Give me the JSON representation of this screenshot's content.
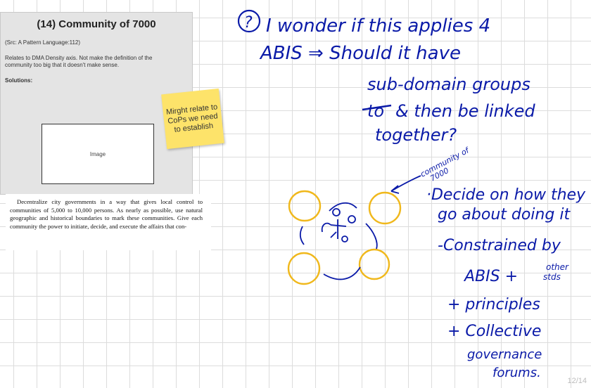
{
  "card": {
    "title": "(14) Community of 7000",
    "source": "(Src: A Pattern Language:112)",
    "description": "Relates to DMA Density axis.  Not make the definition of the community too big that it doesn't make sense.",
    "solutions_label": "Solutions:",
    "image_label": "Image"
  },
  "sticky_note": {
    "text": "Mirght relate to CoPs we need to establish",
    "color": "#fde36a"
  },
  "quote": {
    "text": "Decentralize city governments in a way that gives local control to communities of 5,000 to 10,000 persons. As nearly as possible, use natural geographic and historical boundaries to mark these communities. Give each community the power to initiate, decide, and execute the affairs that con-"
  },
  "handwriting": {
    "question_mark": "?",
    "line1": "I wonder if this applies 4",
    "line2": "ABIS ⇒ Should it have",
    "line3": "sub-domain groups",
    "line4_struck": "to",
    "line4": "& then be linked",
    "line5": "together?",
    "community_label_1": "community of",
    "community_label_2": "7000",
    "note1": "·Decide on how they",
    "note2": "go about doing it",
    "note3": "-Constrained by",
    "note4": "ABIS +",
    "note4_sup_1": "other",
    "note4_sup_2": "stds",
    "note5": "+ principles",
    "note6": "+ Collective",
    "note7": "governance",
    "note8": "forums."
  },
  "colors": {
    "ink_blue": "#0a1aa8",
    "highlight_yellow": "#f0b81c",
    "grid_line": "#dcdcdc"
  },
  "page_indicator": "12/14"
}
